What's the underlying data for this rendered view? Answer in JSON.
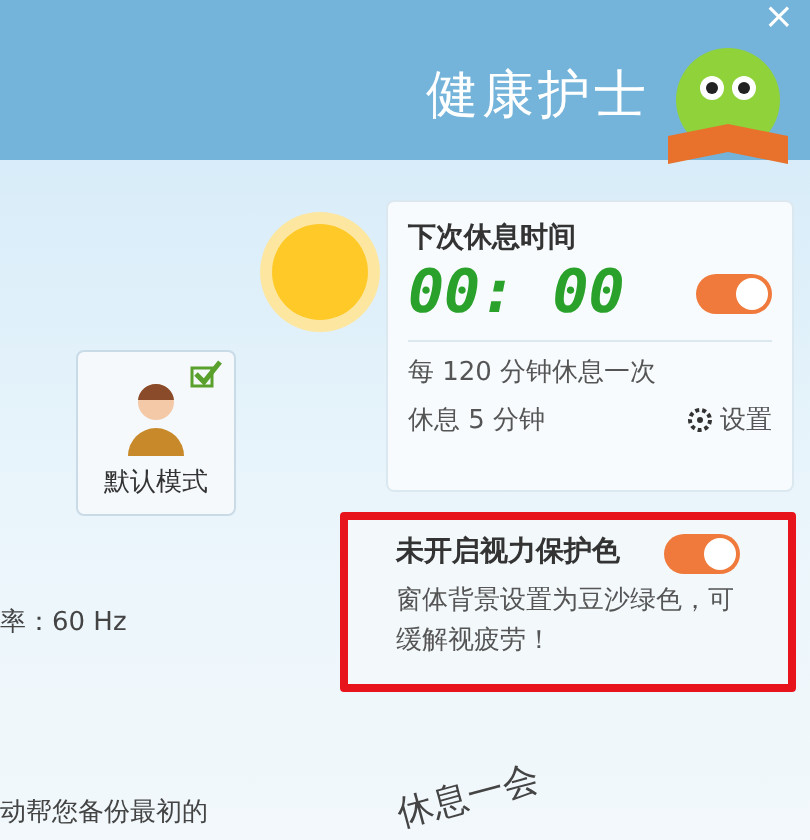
{
  "window": {
    "title": "健康护士",
    "close": "×"
  },
  "rest_card": {
    "title": "下次休息时间",
    "timer": "00: 00",
    "on": true,
    "interval": "每 120 分钟休息一次",
    "duration": "休息 5 分钟",
    "settings": "设置"
  },
  "mode": {
    "label": "默认模式",
    "checked": true
  },
  "refresh_rate": "率：60 Hz",
  "backup_text": "动帮您备份最初的",
  "eye_care": {
    "title": "未开启视力保护色",
    "on": true,
    "description": "窗体背景设置为豆沙绿色，可缓解视疲劳！",
    "highlighted": true
  },
  "rest_button": "休息一会"
}
